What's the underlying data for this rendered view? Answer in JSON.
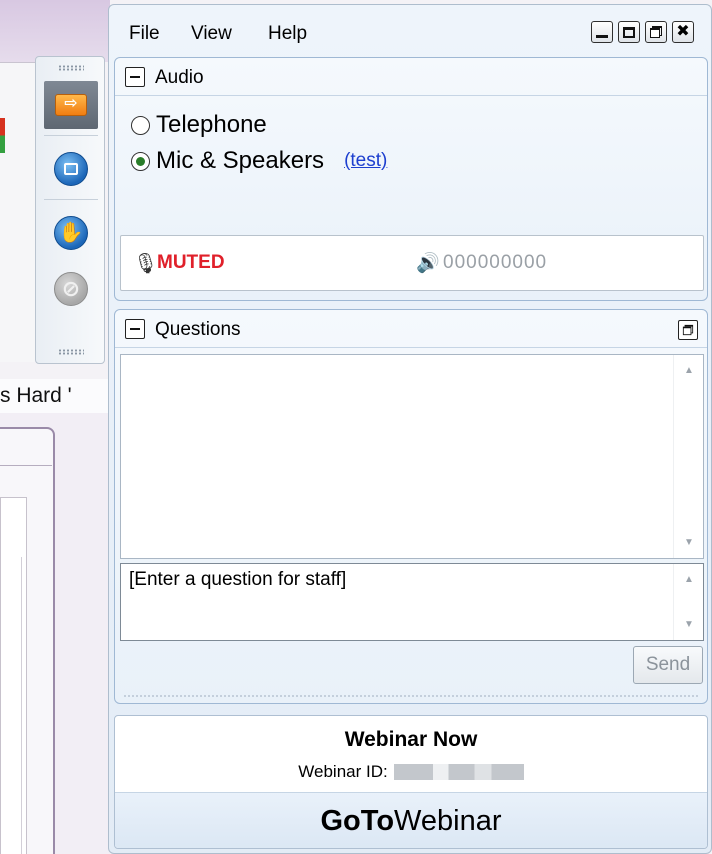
{
  "background": {
    "window_text": "s Hard '"
  },
  "control_toolbar": {
    "buttons": [
      {
        "icon": "arrow-right-icon",
        "glyph": "⇨"
      },
      {
        "icon": "screen-icon"
      },
      {
        "icon": "raise-hand-icon",
        "glyph": "✋"
      },
      {
        "icon": "disabled-pen-icon",
        "glyph": "⊘"
      }
    ]
  },
  "menu": {
    "items": [
      "File",
      "View",
      "Help"
    ]
  },
  "audio": {
    "title": "Audio",
    "options": [
      {
        "label": "Telephone",
        "selected": false
      },
      {
        "label": "Mic & Speakers",
        "selected": true
      }
    ],
    "test_link": "(test)",
    "mic_status": "MUTED",
    "mic_status_color": "#e0202a",
    "speaker_level": "000000000",
    "speaker_level_value": 0
  },
  "questions": {
    "title": "Questions",
    "input_placeholder": "[Enter a question for staff]",
    "send_label": "Send"
  },
  "webinar": {
    "title": "Webinar Now",
    "id_label": "Webinar ID:"
  },
  "brand": {
    "strong": "GoTo",
    "light": "Webinar"
  }
}
